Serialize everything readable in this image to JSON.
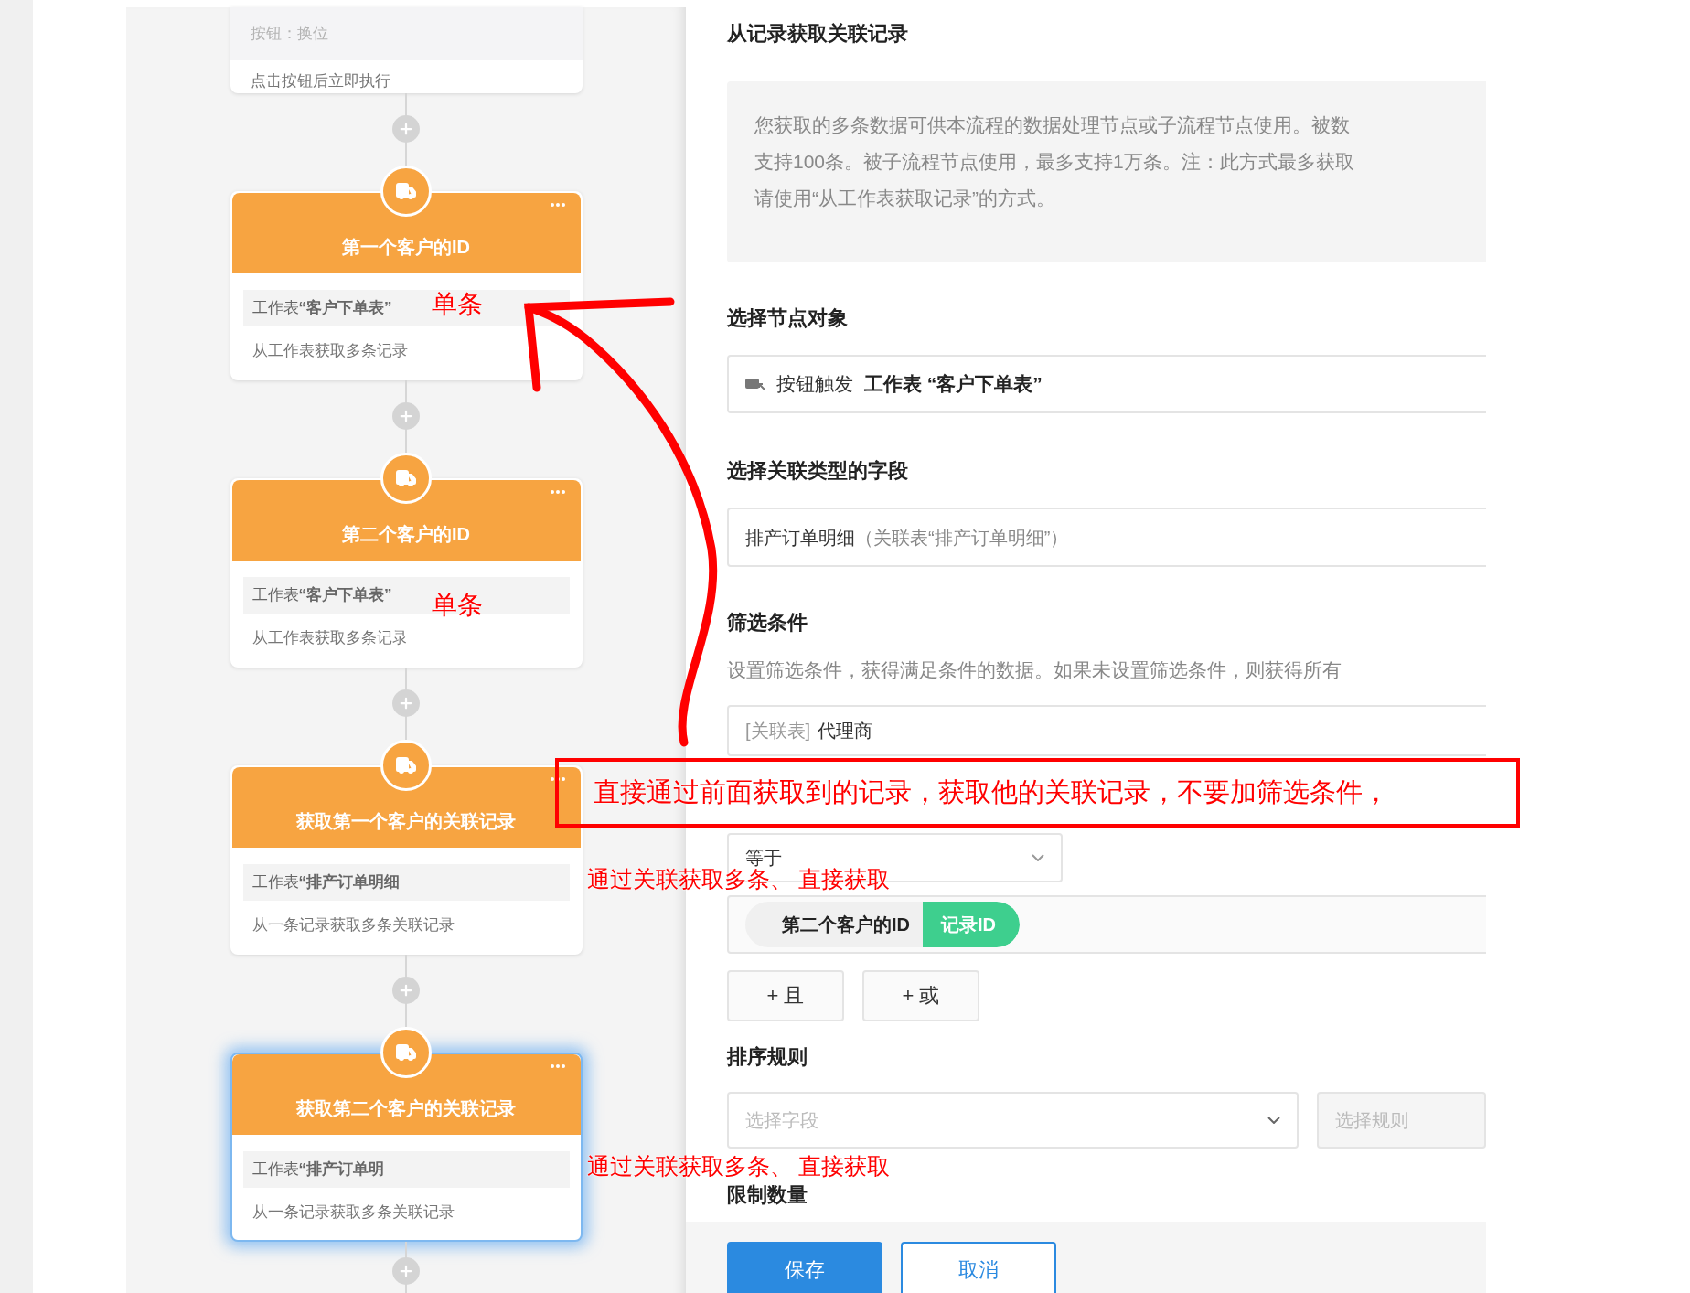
{
  "flow": {
    "trigger": {
      "title": "按钮：换位",
      "subtitle": "点击按钮后立即执行"
    },
    "nodes": [
      {
        "title": "第一个客户的ID",
        "source": "工作表**“客户下单表”**",
        "description": "从工作表获取多条记录",
        "selected": false,
        "annotation": "单条"
      },
      {
        "title": "第二个客户的ID",
        "source": "工作表**“客户下单表”**",
        "description": "从工作表获取多条记录",
        "selected": false,
        "annotation": "单条"
      },
      {
        "title": "获取第一个客户的关联记录",
        "source": "工作表**“排产订单明细**",
        "description": "从一条记录获取多条关联记录",
        "selected": false,
        "annotation": "通过关联获取多条、 直接获取"
      },
      {
        "title": "获取第二个客户的关联记录",
        "source": "工作表**“排产订单明**",
        "description": "从一条记录获取多条关联记录",
        "selected": true,
        "annotation": "通过关联获取多条、 直接获取"
      }
    ]
  },
  "panel": {
    "title": "从记录获取关联记录",
    "notice_lines": [
      "您获取的多条数据可供本流程的数据处理节点或子流程节点使用。被数",
      "支持100条。被子流程节点使用，最多支持1万条。注：此方式最多获取",
      "请使用“从工作表获取记录”的方式。"
    ],
    "node_object": {
      "label": "选择节点对象",
      "trigger": "按钮触发",
      "value": "工作表 “客户下单表”"
    },
    "relation_field": {
      "label": "选择关联类型的字段",
      "value": "排产订单明细",
      "hint": "（关联表“排产订单明细”）"
    },
    "filter": {
      "label": "筛选条件",
      "description": "设置筛选条件，获得满足条件的数据。如果未设置筛选条件，则获得所有",
      "field_tag": "[关联表]",
      "field_name": "代理商",
      "operator": "等于",
      "value_tags": [
        {
          "kind": "node",
          "text": "第二个客户的ID"
        },
        {
          "kind": "field",
          "text": "记录ID"
        }
      ],
      "add_buttons": [
        "+ 且",
        "+ 或"
      ]
    },
    "sort": {
      "label": "排序规则",
      "field_placeholder": "选择字段",
      "rule_placeholder": "选择规则"
    },
    "limit": {
      "label": "限制数量"
    },
    "footer": {
      "buttons": [
        {
          "kind": "primary",
          "label": "保存"
        },
        {
          "kind": "secondary",
          "label": "取消"
        }
      ]
    }
  },
  "note": "直接通过前面获取到的记录，获取他的关联记录，不要加筛选条件，"
}
